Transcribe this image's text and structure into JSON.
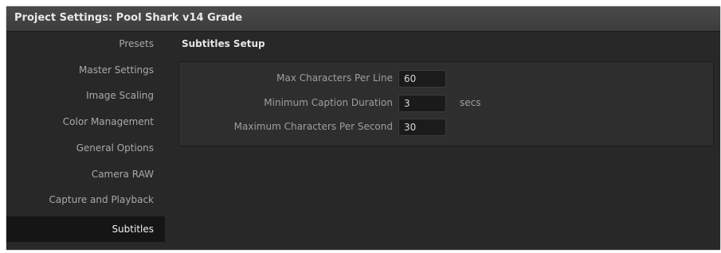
{
  "window": {
    "title": "Project Settings:  Pool Shark v14 Grade"
  },
  "sidebar": {
    "items": [
      {
        "label": "Presets"
      },
      {
        "label": "Master Settings"
      },
      {
        "label": "Image Scaling"
      },
      {
        "label": "Color Management"
      },
      {
        "label": "General Options"
      },
      {
        "label": "Camera RAW"
      },
      {
        "label": "Capture and Playback"
      },
      {
        "label": "Subtitles",
        "selected": true
      }
    ]
  },
  "main": {
    "section_title": "Subtitles Setup",
    "fields": [
      {
        "label": "Max Characters Per Line",
        "value": "60",
        "unit": ""
      },
      {
        "label": "Minimum Caption Duration",
        "value": "3",
        "unit": "secs"
      },
      {
        "label": "Maximum Characters Per Second",
        "value": "30",
        "unit": ""
      }
    ]
  },
  "colors": {
    "background": "#282828",
    "titlebar": "#3c3c3c",
    "selected_item": "#151515",
    "input_background": "#1b1b1b"
  }
}
